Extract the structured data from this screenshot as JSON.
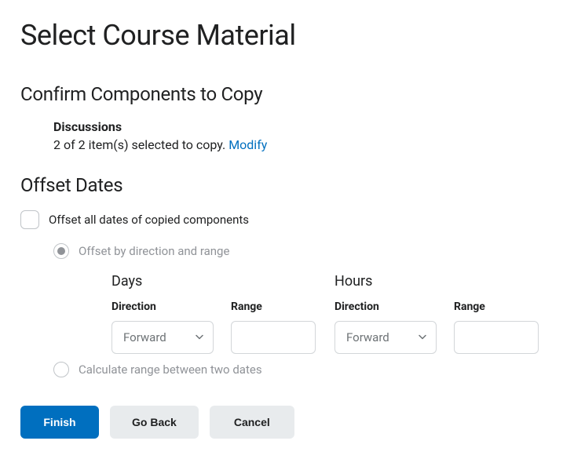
{
  "page": {
    "title": "Select Course Material"
  },
  "confirm": {
    "heading": "Confirm Components to Copy",
    "component": {
      "name": "Discussions",
      "summary": "2 of 2 item(s) selected to copy.",
      "modify_label": "Modify"
    }
  },
  "offset": {
    "heading": "Offset Dates",
    "checkbox_label": "Offset all dates of copied components",
    "radio_direction_label": "Offset by direction and range",
    "radio_calculate_label": "Calculate range between two dates",
    "days": {
      "heading": "Days",
      "direction_label": "Direction",
      "direction_value": "Forward",
      "range_label": "Range",
      "range_value": ""
    },
    "hours": {
      "heading": "Hours",
      "direction_label": "Direction",
      "direction_value": "Forward",
      "range_label": "Range",
      "range_value": ""
    }
  },
  "buttons": {
    "finish": "Finish",
    "go_back": "Go Back",
    "cancel": "Cancel"
  }
}
